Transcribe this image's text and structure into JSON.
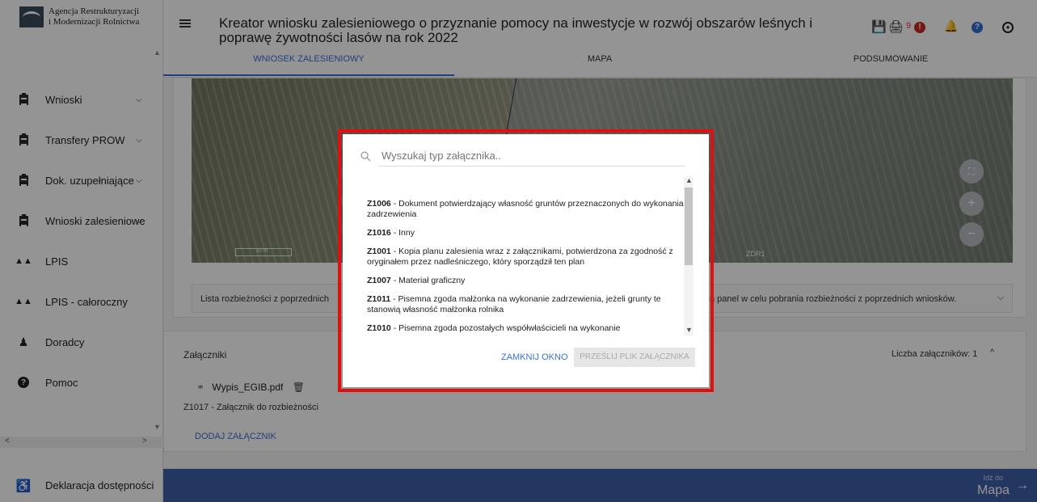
{
  "sidebar": {
    "logo": {
      "line1": "Agencja Restrukturyzacji",
      "line2": "i Modernizacji Rolnictwa"
    },
    "items": [
      {
        "label": "Wnioski",
        "icon": "clipboard-icon",
        "chevron": "⌄"
      },
      {
        "label": "Transfery PROW",
        "icon": "clipboard-icon",
        "chevron": "⌄"
      },
      {
        "label": "Dok. uzupełniające",
        "icon": "clipboard-icon",
        "chevron": "⌄"
      },
      {
        "label": "Wnioski zalesieniowe",
        "icon": "clipboard-icon",
        "chevron": "⌄"
      },
      {
        "label": "LPIS",
        "icon": "mountain-icon",
        "chevron": ""
      },
      {
        "label": "LPIS - całoroczny",
        "icon": "mountain-icon",
        "chevron": ""
      },
      {
        "label": "Doradcy",
        "icon": "person-icon",
        "chevron": ""
      },
      {
        "label": "Pomoc",
        "icon": "help-icon",
        "chevron": ""
      }
    ],
    "footer": "Deklaracja dostępności"
  },
  "header": {
    "title": "Kreator wniosku zalesieniowego o przyznanie pomocy na inwestycje w rozwój obszarów leśnych i poprawę żywotności lasów na rok 2022",
    "notification_count": "9",
    "tabs": [
      {
        "label": "WNIOSEK ZALESIENIOWY",
        "active": true
      },
      {
        "label": "MAPA",
        "active": false
      },
      {
        "label": "PODSUMOWANIE",
        "active": false
      }
    ]
  },
  "map": {
    "scale": "10 m",
    "parcel_label": "ZDR1"
  },
  "discrepancy": {
    "left": "Lista rozbieżności z poprzednich",
    "right": "ń panel w celu pobrania rozbieżności z poprzednich wniosków."
  },
  "attachments": {
    "title": "Załączniki",
    "count_label": "Liczba załączników: 1",
    "file_name": "Wypis_EGIB.pdf",
    "type_label": "Z1017 - Załącznik do rozbieżności",
    "add_label": "DODAJ ZAŁĄCZNIK"
  },
  "footer_bar": {
    "go_to": "Idź do",
    "target": "Mapa"
  },
  "modal": {
    "search_placeholder": "Wyszukaj typ załącznika..",
    "items": [
      {
        "code": "Z1006",
        "text": " - Dokument potwierdzający własność gruntów przeznaczonych do wykonania zadrzewienia"
      },
      {
        "code": "Z1016",
        "text": " - Inny"
      },
      {
        "code": "Z1001",
        "text": " - Kopia planu zalesienia wraz z załącznikami, potwierdzona za zgodność z oryginałem przez nadleśniczego, który sporządził ten plan"
      },
      {
        "code": "Z1007",
        "text": " - Materiał graficzny"
      },
      {
        "code": "Z1011",
        "text": " - Pisemna zgoda małżonka na wykonanie zadrzewienia, jeżeli grunty te stanowią własność małżonka rolnika"
      },
      {
        "code": "Z1010",
        "text": " - Pisemna zgoda pozostałych współwłaścicieli na wykonanie"
      }
    ],
    "close_label": "ZAMKNIJ OKNO",
    "send_label": "PRZEŚLIJ PLIK ZAŁĄCZNIKA"
  }
}
